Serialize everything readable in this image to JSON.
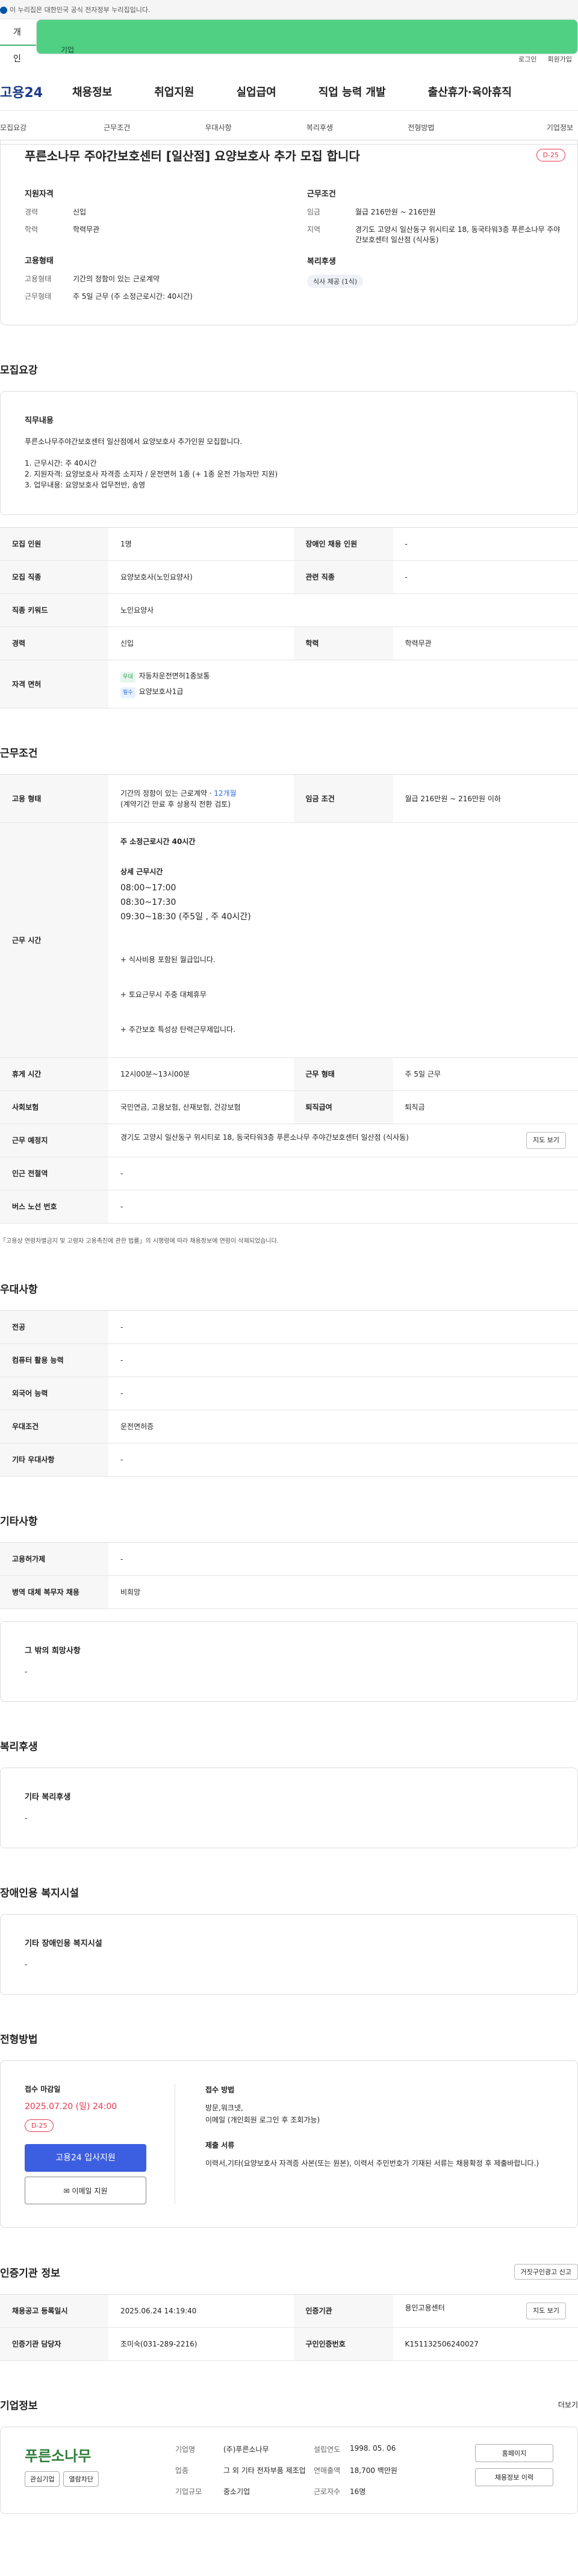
{
  "gov_bar": "이 누리집은 대한민국 공식 전자정부 누리집입니다.",
  "tabs": [
    "개인",
    "기업"
  ],
  "util": [
    "로그인",
    "회원가입"
  ],
  "logo": "고용24",
  "gnb": [
    "채용정보",
    "취업지원",
    "실업급여",
    "직업 능력 개발",
    "출산휴가·육아휴직"
  ],
  "subnav": [
    "모집요강",
    "근무조건",
    "우대사항",
    "복리후생",
    "전형방법",
    "기업정보"
  ],
  "summary": {
    "title": "푸른소나무 주야간보호센터 [일산점] 요양보호사 추가 모집 합니다",
    "dday": "D-25",
    "qual_title": "지원자격",
    "qual": [
      [
        "경력",
        "신입"
      ],
      [
        "학력",
        "학력무관"
      ]
    ],
    "emp_title": "고용형태",
    "emp": [
      [
        "고용형태",
        "기간의 정함이 있는 근로계약"
      ],
      [
        "근무형태",
        "주 5일 근무 (주 소정근로시간: 40시간)"
      ]
    ],
    "work_title": "근무조건",
    "work": [
      [
        "임금",
        "월급 216만원 ~ 216만원"
      ],
      [
        "지역",
        "경기도 고양시 일산동구 위시티로 18, 동국타워3층 푸른소나무 주야간보호센터 일산점 (식사동)"
      ]
    ],
    "welfare_title": "복리후생",
    "welfare_chip": "식사 제공 (1식)"
  },
  "recruit": {
    "title": "모집요강",
    "duty_title": "직무내용",
    "duty_lines": [
      "푸른소나무주야간보호센터 일산점에서 요양보호사 추가인원 모집합니다.",
      "",
      "1. 근무시간:  주 40시간",
      "2. 지원자격:  요양보호사 자격증 소지자 / 운전면허 1종  (+ 1종 운전 가능자만 지원)",
      "3. 업무내용:  요양보호사 업무전반, 송영"
    ],
    "rows": [
      {
        "k1": "모집 인원",
        "v1": "1명",
        "k2": "장애인 채용 인원",
        "v2": "-"
      },
      {
        "k1": "모집 직종",
        "v1": "요양보호사(노인요양사)",
        "k2": "관련 직종",
        "v2": "-"
      },
      {
        "k1": "직종 키워드",
        "v1": "노인요양사"
      },
      {
        "k1": "경력",
        "v1": "신입",
        "k2": "학력",
        "v2": "학력무관"
      }
    ],
    "license_label": "자격 면허",
    "license_tags": [
      "우대",
      "필수"
    ],
    "licenses": [
      "자동차운전면허1종보통",
      "요양보호사1급"
    ]
  },
  "work": {
    "title": "근무조건",
    "emp_label": "고용 형태",
    "emp_value": "기간의 정함이 있는 근로계약 · ",
    "emp_months": "12개월",
    "emp_note": "(계약기간 만료 후 상용직 전환 검토)",
    "pay_label": "임금 조건",
    "pay_value": "월급 216만원 ~ 216만원 이하",
    "time_label": "근무 시간",
    "time_head": "주 소정근로시간  40시간",
    "time_detail_title": "상세 근무시간",
    "time_lines": [
      "08:00~17:00",
      "08:30~17:30",
      "09:30~18:30 (주5일 , 주 40시간)"
    ],
    "time_notes": [
      "+ 식사비용 포함된 월급입니다.",
      "+ 토요근무시 주중 대체휴무",
      "+ 주간보호 특성상 탄력근무제입니다."
    ],
    "rows": [
      {
        "k1": "휴게 시간",
        "v1": "12시00분~13시00분",
        "k2": "근무 형태",
        "v2": "주 5일 근무"
      },
      {
        "k1": "사회보험",
        "v1": "국민연금, 고용보험, 산재보험, 건강보험",
        "k2": "퇴직급여",
        "v2": "퇴직금"
      }
    ],
    "place_label": "근무 예정지",
    "place_value": "경기도 고양시 일산동구 위시티로 18, 동국타워3층 푸른소나무 주야간보호센터 일산점 (식사동)",
    "map_btn": "지도 보기",
    "station_label": "인근 전철역",
    "station_value": "-",
    "bus_label": "버스 노선 번호",
    "bus_value": "-",
    "note": "「고용상 연령차별금지 및 고령자 고용촉진에 관한 법률」의 시행령에 따라 채용정보에 연령이 삭제되었습니다."
  },
  "pref": {
    "title": "우대사항",
    "rows": [
      [
        "전공",
        "-"
      ],
      [
        "컴퓨터 활용 능력",
        "-"
      ],
      [
        "외국어 능력",
        "-"
      ],
      [
        "우대조건",
        "운전면허증"
      ],
      [
        "기타 우대사항",
        "-"
      ]
    ]
  },
  "etc": {
    "title": "기타사항",
    "rows": [
      [
        "고용허가제",
        "-"
      ],
      [
        "병역 대체 복무자 채용",
        "비희망"
      ]
    ],
    "other_title": "그 밖의 희망사항",
    "other_value": "-"
  },
  "welfare": {
    "title": "복리후생",
    "box_title": "기타 복리후생",
    "value": "-"
  },
  "disabled": {
    "title": "장애인용 복지시설",
    "box_title": "기타 장애인용 복지시설",
    "value": "-"
  },
  "selection": {
    "title": "전형방법",
    "deadline_label": "접수 마감일",
    "deadline": "2025.07.20 (일) 24:00",
    "dday": "D-25",
    "apply_btn": "고용24 입사지원",
    "email_btn": "이메일 지원",
    "method_title": "접수 방법",
    "methods": [
      "방문,워크넷,",
      "이메일 (개인회원 로그인 후 조회가능)"
    ],
    "docs_title": "제출 서류",
    "docs": "이력서,기타(요양보호사 자격증 사본(또는 원본), 이력서 주민번호가 기재된 서류는 채용확정 후 제출바랍니다.)"
  },
  "agency": {
    "title": "인증기관 정보",
    "report_btn": "거짓구인광고 신고",
    "rows": [
      {
        "k1": "채용공고 등록일시",
        "v1": "2025.06.24 14:19:40",
        "k2": "인증기관",
        "v2": "용인고용센터",
        "btn": "지도 보기"
      },
      {
        "k1": "인증기관 담당자",
        "v1": "조미숙(031-289-2216)",
        "k2": "구인인증번호",
        "v2": "K151132506240027"
      }
    ]
  },
  "company": {
    "title": "기업정보",
    "more": "더보기",
    "name": "푸른소나무",
    "fav_btn": "관심기업",
    "follow_btn": "열람차단",
    "info": [
      [
        "기업명",
        "(주)푸른소나무",
        "설립연도",
        "1998. 05. 06"
      ],
      [
        "업종",
        "그 외 기타 전자부품 제조업",
        "연매출액",
        "18,700 백만원"
      ],
      [
        "기업규모",
        "중소기업",
        "근로자수",
        "16명"
      ]
    ],
    "home_btn": "홈페이지",
    "list_btn": "채용정보 이력"
  }
}
